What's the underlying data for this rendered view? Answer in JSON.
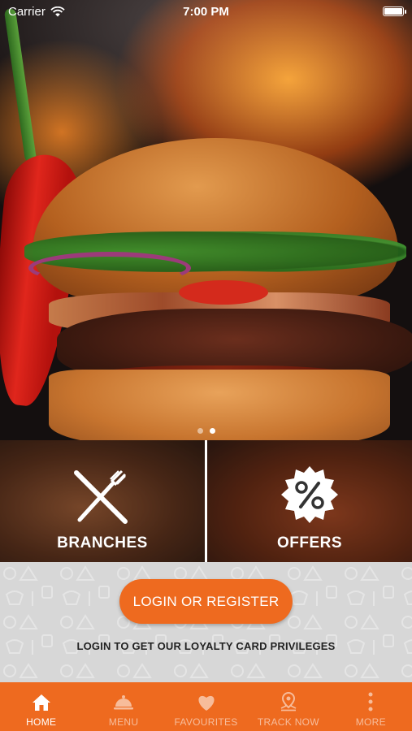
{
  "status_bar": {
    "carrier": "Carrier",
    "time": "7:00 PM"
  },
  "hero": {
    "slides": 2,
    "active_slide": 1
  },
  "tiles": [
    {
      "label": "BRANCHES",
      "icon": "fork-knife-icon"
    },
    {
      "label": "OFFERS",
      "icon": "percent-badge-icon"
    }
  ],
  "login": {
    "button_label": "LOGIN OR REGISTER",
    "caption": "LOGIN TO GET OUR LOYALTY CARD PRIVILEGES"
  },
  "tab_bar": {
    "items": [
      {
        "label": "HOME",
        "icon": "home-icon",
        "active": true
      },
      {
        "label": "MENU",
        "icon": "cloche-icon",
        "active": false
      },
      {
        "label": "FAVOURITES",
        "icon": "heart-icon",
        "active": false
      },
      {
        "label": "TRACK NOW",
        "icon": "location-pin-icon",
        "active": false
      },
      {
        "label": "MORE",
        "icon": "more-dots-icon",
        "active": false
      }
    ]
  },
  "colors": {
    "accent": "#ee6a1f",
    "pattern_bg": "#d7d7d7"
  }
}
